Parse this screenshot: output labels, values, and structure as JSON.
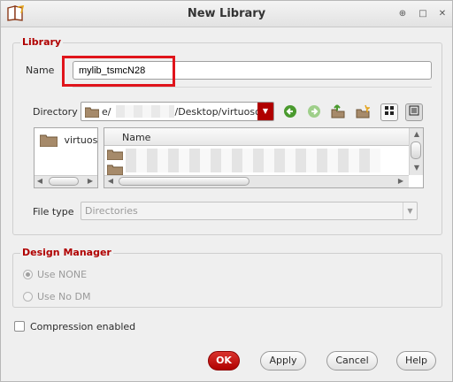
{
  "window": {
    "title": "New Library",
    "app_icon": "book-icon",
    "controls": {
      "up": "⊕",
      "maximize": "□",
      "close": "✕"
    }
  },
  "library": {
    "legend": "Library",
    "name_label": "Name",
    "name_value": "mylib_tsmcN28",
    "directory_label": "Directory",
    "directory_prefix": "e/",
    "directory_suffix": "/Desktop/virtuoso",
    "left_panel_item": "virtuos",
    "list_column_header": "Name",
    "file_type_label": "File type",
    "file_type_value": "Directories"
  },
  "design_manager": {
    "legend": "Design Manager",
    "use_none_label": "Use NONE",
    "use_none_selected": true,
    "use_no_dm_label": "Use No DM"
  },
  "compression": {
    "label": "Compression enabled",
    "checked": false
  },
  "buttons": {
    "ok": "OK",
    "apply": "Apply",
    "cancel": "Cancel",
    "help": "Help"
  },
  "colors": {
    "accent": "#b00000",
    "highlight_box": "#e0141b"
  }
}
